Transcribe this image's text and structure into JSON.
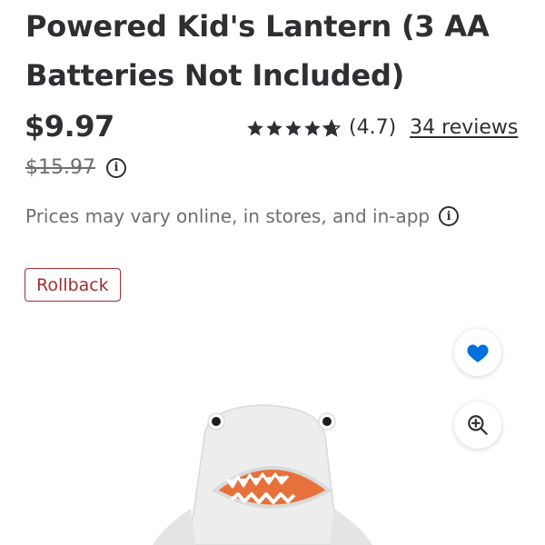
{
  "product": {
    "title": "Powered Kid's Lantern (3 AA Batteries Not Included)",
    "price": "$9.97",
    "was_price": "$15.97",
    "rating_value": "(4.7)",
    "reviews_label": "34 reviews",
    "stars_filled": 4.7,
    "stars_total": 5,
    "price_disclaimer": "Prices may vary online, in stores, and in-app",
    "badge": "Rollback"
  },
  "icons": {
    "info": "info-icon",
    "favorite": "heart-icon",
    "zoom": "zoom-in-icon",
    "star": "star-icon"
  },
  "colors": {
    "text": "#2e2f32",
    "muted": "#6d6e71",
    "rollback": "#a32d2d",
    "heart": "#0071dc",
    "mouth": "#e8703a"
  }
}
